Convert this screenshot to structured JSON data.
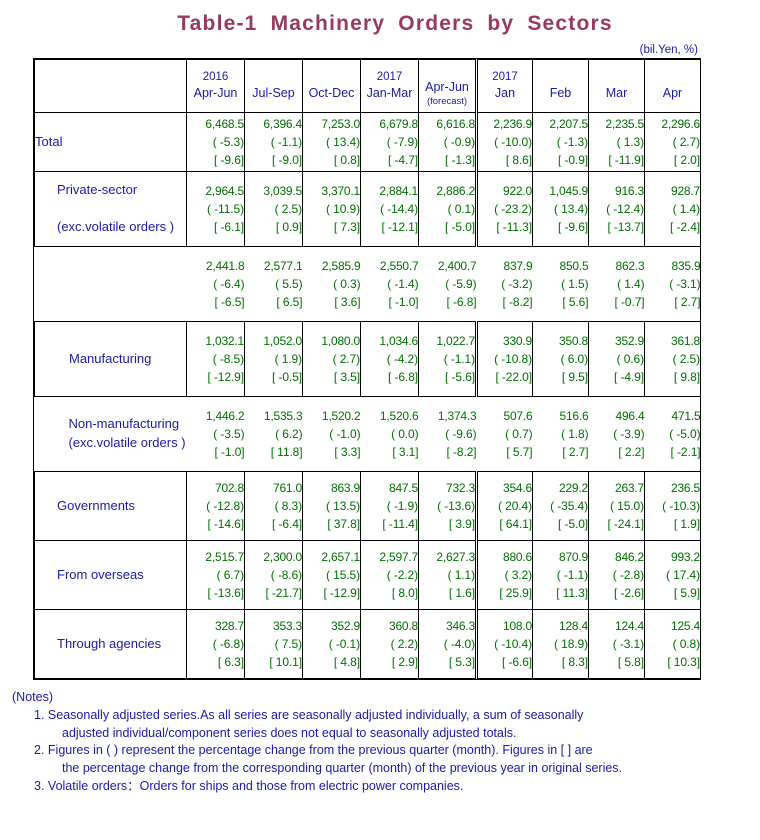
{
  "title": "Table-1  Machinery  Orders  by  Sectors",
  "unit": "(bil.Yen, %)",
  "colors": {
    "title": "#963a5f",
    "label": "#1a1aa8",
    "value": "#007000"
  },
  "header": {
    "corner": "",
    "columns": [
      {
        "year": "2016",
        "period": "Apr-Jun",
        "note": ""
      },
      {
        "year": "",
        "period": "Jul-Sep",
        "note": ""
      },
      {
        "year": "",
        "period": "Oct-Dec",
        "note": ""
      },
      {
        "year": "2017",
        "period": "Jan-Mar",
        "note": ""
      },
      {
        "year": "",
        "period": "Apr-Jun",
        "note": "(forecast)"
      },
      {
        "year": "2017",
        "period": "Jan",
        "note": ""
      },
      {
        "year": "",
        "period": "Feb",
        "note": ""
      },
      {
        "year": "",
        "period": "Mar",
        "note": ""
      },
      {
        "year": "",
        "period": "Apr",
        "note": ""
      }
    ]
  },
  "chart_data": {
    "type": "table",
    "title": "Table-1  Machinery  Orders  by  Sectors",
    "unit": "(bil.Yen, %)",
    "categories": [
      "2016 Apr-Jun",
      "2016 Jul-Sep",
      "2016 Oct-Dec",
      "2017 Jan-Mar",
      "2017 Apr-Jun (forecast)",
      "2017 Jan",
      "2017 Feb",
      "2017 Mar",
      "2017 Apr"
    ],
    "row_labels": [
      "Total",
      "Private-sector (exc.volatile orders )",
      "Manufacturing",
      "Non-manufacturing (exc.volatile orders )",
      "Governments",
      "From overseas",
      "Through agencies"
    ],
    "note": "Each cell holds level (bil.Yen), ( ) = % change from previous quarter/month, [ ] = % change from same quarter/month of previous year."
  },
  "rows": [
    {
      "label": "Total",
      "indent": 0,
      "lines": [
        {
          "level": "6,468.5",
          "qoq": "( -5.3)",
          "yoy": "[ -9.6]"
        },
        {
          "level": "6,396.4",
          "qoq": "( -1.1)",
          "yoy": "[ -9.0]"
        },
        {
          "level": "7,253.0",
          "qoq": "( 13.4)",
          "yoy": "[  0.8]"
        },
        {
          "level": "6,679.8",
          "qoq": "( -7.9)",
          "yoy": "[ -4.7]"
        },
        {
          "level": "6,616.8",
          "qoq": "( -0.9)",
          "yoy": "[ -1.3]"
        },
        {
          "level": "2,236.9",
          "qoq": "( -10.0)",
          "yoy": "[  8.6]"
        },
        {
          "level": "2,207.5",
          "qoq": "( -1.3)",
          "yoy": "[ -0.9]"
        },
        {
          "level": "2,235.5",
          "qoq": "(  1.3)",
          "yoy": "[ -11.9]"
        },
        {
          "level": "2,296.6",
          "qoq": "(  2.7)",
          "yoy": "[  2.0]"
        }
      ]
    },
    {
      "label": "Private-sector",
      "sublabel": "(exc.volatile orders )",
      "indent": 1,
      "lines": [
        {
          "level": "2,964.5",
          "qoq": "( -11.5)",
          "yoy": "[ -6.1]"
        },
        {
          "level": "3,039.5",
          "qoq": "(  2.5)",
          "yoy": "[  0.9]"
        },
        {
          "level": "3,370.1",
          "qoq": "( 10.9)",
          "yoy": "[  7.3]"
        },
        {
          "level": "2,884.1",
          "qoq": "( -14.4)",
          "yoy": "[ -12.1]"
        },
        {
          "level": "2,886.2",
          "qoq": "(  0.1)",
          "yoy": "[ -5.0]"
        },
        {
          "level": "922.0",
          "qoq": "( -23.2)",
          "yoy": "[ -11.3]"
        },
        {
          "level": "1,045.9",
          "qoq": "( 13.4)",
          "yoy": "[ -9.6]"
        },
        {
          "level": "916.3",
          "qoq": "( -12.4)",
          "yoy": "[ -13.7]"
        },
        {
          "level": "928.7",
          "qoq": "(  1.4)",
          "yoy": "[ -2.4]"
        }
      ],
      "lines2": [
        {
          "level": "2,441.8",
          "qoq": "( -6.4)",
          "yoy": "[ -6.5]"
        },
        {
          "level": "2,577.1",
          "qoq": "(  5.5)",
          "yoy": "[  6.5]"
        },
        {
          "level": "2,585.9",
          "qoq": "(  0.3)",
          "yoy": "[  3.6]"
        },
        {
          "level": "2,550.7",
          "qoq": "( -1.4)",
          "yoy": "[ -1.0]"
        },
        {
          "level": "2,400.7",
          "qoq": "( -5.9)",
          "yoy": "[ -6.8]"
        },
        {
          "level": "837.9",
          "qoq": "( -3.2)",
          "yoy": "[ -8.2]"
        },
        {
          "level": "850.5",
          "qoq": "(  1.5)",
          "yoy": "[  5.6]"
        },
        {
          "level": "862.3",
          "qoq": "(  1.4)",
          "yoy": "[ -0.7]"
        },
        {
          "level": "835.9",
          "qoq": "( -3.1)",
          "yoy": "[  2.7]"
        }
      ]
    },
    {
      "label": "Manufacturing",
      "indent": 2,
      "lines": [
        {
          "level": "1,032.1",
          "qoq": "( -8.5)",
          "yoy": "[ -12.9]"
        },
        {
          "level": "1,052.0",
          "qoq": "(  1.9)",
          "yoy": "[ -0.5]"
        },
        {
          "level": "1,080.0",
          "qoq": "(  2.7)",
          "yoy": "[  3.5]"
        },
        {
          "level": "1,034.6",
          "qoq": "( -4.2)",
          "yoy": "[ -6.8]"
        },
        {
          "level": "1,022.7",
          "qoq": "( -1.1)",
          "yoy": "[ -5.6]"
        },
        {
          "level": "330.9",
          "qoq": "( -10.8)",
          "yoy": "[ -22.0]"
        },
        {
          "level": "350.8",
          "qoq": "(  6.0)",
          "yoy": "[  9.5]"
        },
        {
          "level": "352.9",
          "qoq": "(  0.6)",
          "yoy": "[ -4.9]"
        },
        {
          "level": "361.8",
          "qoq": "(  2.5)",
          "yoy": "[  9.8]"
        }
      ]
    },
    {
      "label": "Non-manufacturing",
      "sublabel": "(exc.volatile orders )",
      "indent": 2,
      "tight": true,
      "lines": [
        {
          "level": "1,446.2",
          "qoq": "( -3.5)",
          "yoy": "[ -1.0]"
        },
        {
          "level": "1,535.3",
          "qoq": "(  6.2)",
          "yoy": "[ 11.8]"
        },
        {
          "level": "1,520.2",
          "qoq": "( -1.0)",
          "yoy": "[  3.3]"
        },
        {
          "level": "1,520.6",
          "qoq": "(  0.0)",
          "yoy": "[  3.1]"
        },
        {
          "level": "1,374.3",
          "qoq": "( -9.6)",
          "yoy": "[ -8.2]"
        },
        {
          "level": "507.6",
          "qoq": "(  0.7)",
          "yoy": "[  5.7]"
        },
        {
          "level": "516.6",
          "qoq": "(  1.8)",
          "yoy": "[  2.7]"
        },
        {
          "level": "496.4",
          "qoq": "( -3.9)",
          "yoy": "[  2.2]"
        },
        {
          "level": "471.5",
          "qoq": "( -5.0)",
          "yoy": "[ -2.1]"
        }
      ]
    },
    {
      "label": "Governments",
      "indent": 1,
      "lines": [
        {
          "level": "702.8",
          "qoq": "( -12.8)",
          "yoy": "[ -14.6]"
        },
        {
          "level": "761.0",
          "qoq": "(  8.3)",
          "yoy": "[ -6.4]"
        },
        {
          "level": "863.9",
          "qoq": "( 13.5)",
          "yoy": "[ 37.8]"
        },
        {
          "level": "847.5",
          "qoq": "( -1.9)",
          "yoy": "[ -11.4]"
        },
        {
          "level": "732.3",
          "qoq": "( -13.6)",
          "yoy": "[  3.9]"
        },
        {
          "level": "354.6",
          "qoq": "( 20.4)",
          "yoy": "[ 64.1]"
        },
        {
          "level": "229.2",
          "qoq": "( -35.4)",
          "yoy": "[ -5.0]"
        },
        {
          "level": "263.7",
          "qoq": "( 15.0)",
          "yoy": "[ -24.1]"
        },
        {
          "level": "236.5",
          "qoq": "( -10.3)",
          "yoy": "[  1.9]"
        }
      ]
    },
    {
      "label": "From overseas",
      "indent": 1,
      "lines": [
        {
          "level": "2,515.7",
          "qoq": "(  6.7)",
          "yoy": "[ -13.6]"
        },
        {
          "level": "2,300.0",
          "qoq": "( -8.6)",
          "yoy": "[ -21.7]"
        },
        {
          "level": "2,657.1",
          "qoq": "( 15.5)",
          "yoy": "[ -12.9]"
        },
        {
          "level": "2,597.7",
          "qoq": "( -2.2)",
          "yoy": "[  8.0]"
        },
        {
          "level": "2,627.3",
          "qoq": "(  1.1)",
          "yoy": "[  1.6]"
        },
        {
          "level": "880.6",
          "qoq": "(  3.2)",
          "yoy": "[ 25.9]"
        },
        {
          "level": "870.9",
          "qoq": "( -1.1)",
          "yoy": "[ 11.3]"
        },
        {
          "level": "846.2",
          "qoq": "( -2.8)",
          "yoy": "[ -2.6]"
        },
        {
          "level": "993.2",
          "qoq": "( 17.4)",
          "yoy": "[  5.9]"
        }
      ]
    },
    {
      "label": "Through agencies",
      "indent": 1,
      "lines": [
        {
          "level": "328.7",
          "qoq": "( -6.8)",
          "yoy": "[  6.3]"
        },
        {
          "level": "353.3",
          "qoq": "(  7.5)",
          "yoy": "[ 10.1]"
        },
        {
          "level": "352.9",
          "qoq": "( -0.1)",
          "yoy": "[  4.8]"
        },
        {
          "level": "360.8",
          "qoq": "(  2.2)",
          "yoy": "[  2.9]"
        },
        {
          "level": "346.3",
          "qoq": "( -4.0)",
          "yoy": "[  5.3]"
        },
        {
          "level": "108.0",
          "qoq": "( -10.4)",
          "yoy": "[ -6.6]"
        },
        {
          "level": "128.4",
          "qoq": "( 18.9)",
          "yoy": "[  8.3]"
        },
        {
          "level": "124.4",
          "qoq": "( -3.1)",
          "yoy": "[  5.8]"
        },
        {
          "level": "125.4",
          "qoq": "(  0.8)",
          "yoy": "[ 10.3]"
        }
      ]
    }
  ],
  "notes": {
    "heading": "(Notes)",
    "items": [
      {
        "num": "1.",
        "line1": "Seasonally adjusted series.As all series are seasonally adjusted individually, a sum of seasonally",
        "line2": "adjusted individual/component series does not equal to seasonally adjusted totals."
      },
      {
        "num": "2.",
        "line1": "Figures in ( ) represent the percentage change from the previous quarter (month). Figures in [ ] are",
        "line2": "the percentage change from the corresponding quarter (month) of the previous year in original series."
      },
      {
        "num": "3.",
        "line1": "Volatile orders：Orders for ships and those from electric power companies.",
        "line2": ""
      }
    ]
  }
}
